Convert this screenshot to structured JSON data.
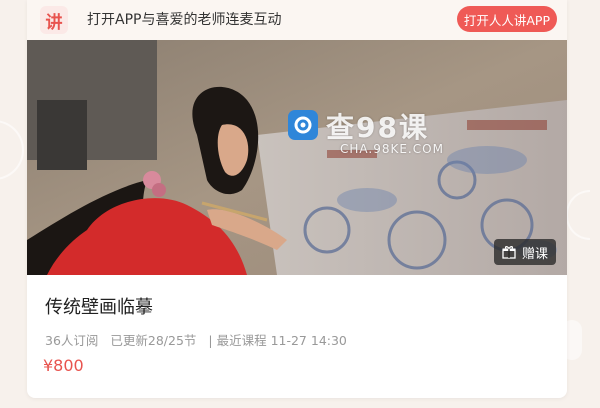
{
  "banner": {
    "logo_text": "讲",
    "promo_text": "打开APP与喜爱的老师连麦互动",
    "open_app_label": "打开人人讲APP"
  },
  "cover": {
    "watermark_main": "查98课",
    "watermark_sub": "CHA.98KE.COM",
    "gift_label": "赠课"
  },
  "course": {
    "title": "传统壁画临摹",
    "subscribers": "36人订阅",
    "updates": "已更新28/25节",
    "latest": "| 最近课程 11-27 14:30",
    "price": "¥800"
  },
  "colors": {
    "accent": "#ef5a56",
    "price": "#e8534e",
    "background": "#f7f1ec"
  },
  "icons": {
    "gift": "gift-icon",
    "watermark": "watermark-logo-icon"
  }
}
